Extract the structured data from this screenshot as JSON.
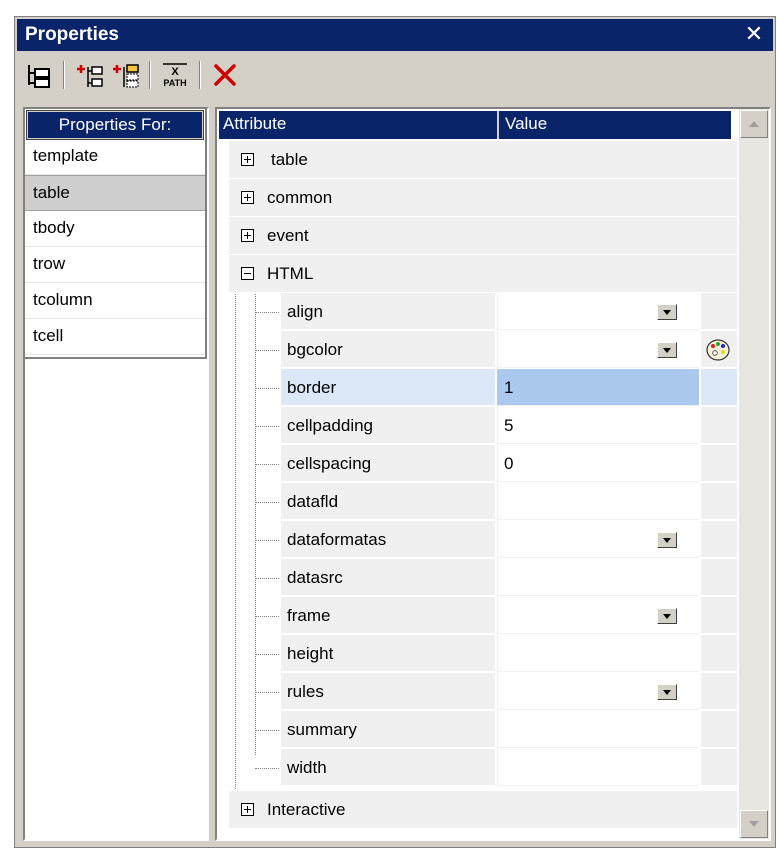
{
  "window": {
    "title": "Properties",
    "close_glyph": "✕"
  },
  "toolbar": {
    "buttons": [
      {
        "name": "tree-view-icon"
      },
      {
        "name": "add-before-icon"
      },
      {
        "name": "add-after-icon"
      },
      {
        "name": "xpath-icon",
        "text_top": "X",
        "text_bottom": "PATH"
      },
      {
        "name": "delete-icon",
        "color": "#cc0000"
      }
    ]
  },
  "left_panel": {
    "header": "Properties For:",
    "items": [
      "template",
      "table",
      "tbody",
      "trow",
      "tcolumn",
      "tcell"
    ],
    "selected": "table"
  },
  "grid": {
    "col_attribute": "Attribute",
    "col_value": "Value",
    "groups": {
      "table": "table",
      "common": "common",
      "event": "event",
      "html": "HTML",
      "interactive": "Interactive"
    },
    "rows": [
      {
        "attr": "align",
        "value": "",
        "dropdown": true
      },
      {
        "attr": "bgcolor",
        "value": "",
        "dropdown": true,
        "palette": true
      },
      {
        "attr": "border",
        "value": "1",
        "selected": true
      },
      {
        "attr": "cellpadding",
        "value": "5"
      },
      {
        "attr": "cellspacing",
        "value": "0"
      },
      {
        "attr": "datafld",
        "value": ""
      },
      {
        "attr": "dataformatas",
        "value": "",
        "dropdown": true
      },
      {
        "attr": "datasrc",
        "value": ""
      },
      {
        "attr": "frame",
        "value": "",
        "dropdown": true
      },
      {
        "attr": "height",
        "value": ""
      },
      {
        "attr": "rules",
        "value": "",
        "dropdown": true
      },
      {
        "attr": "summary",
        "value": ""
      },
      {
        "attr": "width",
        "value": ""
      }
    ]
  },
  "colors": {
    "header_bg": "#0a246a",
    "selection_value": "#abc8ef",
    "selection_attr": "#dce8f8"
  }
}
